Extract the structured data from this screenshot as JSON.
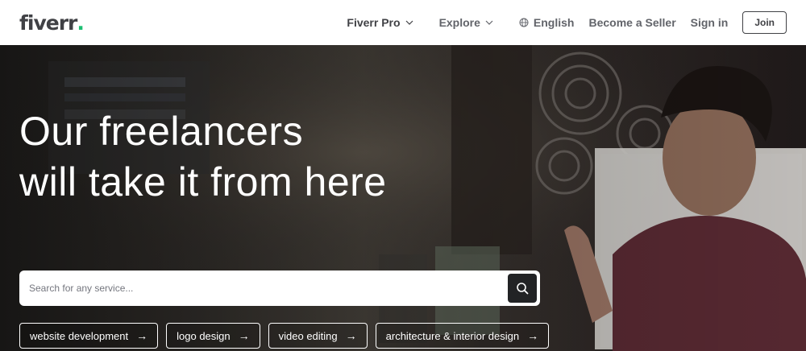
{
  "header": {
    "logo_text": "fiverr",
    "logo_dot": ".",
    "nav": {
      "fiverr_pro": "Fiverr Pro",
      "explore": "Explore",
      "language": "English",
      "become_seller": "Become a Seller",
      "sign_in": "Sign in",
      "join": "Join"
    }
  },
  "hero": {
    "headline_line1": "Our freelancers",
    "headline_line2": "will take it from here",
    "search": {
      "placeholder": "Search for any service..."
    },
    "chips": [
      {
        "label": "website development",
        "arrow": "→"
      },
      {
        "label": "logo design",
        "arrow": "→"
      },
      {
        "label": "video editing",
        "arrow": "→"
      },
      {
        "label": "architecture & interior design",
        "arrow": "→"
      }
    ]
  },
  "colors": {
    "brand_green": "#1dbf73",
    "text_dark": "#404145",
    "search_button": "#222325"
  }
}
